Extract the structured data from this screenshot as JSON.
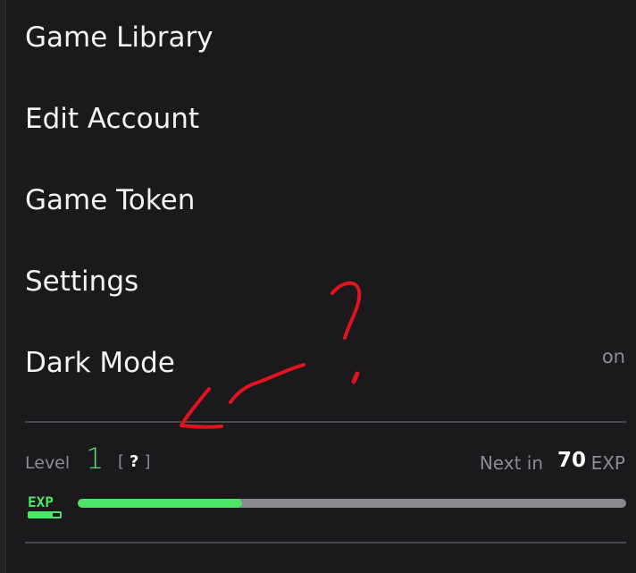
{
  "menu": {
    "items": [
      {
        "label": "Game Library"
      },
      {
        "label": "Edit Account"
      },
      {
        "label": "Game Token"
      },
      {
        "label": "Settings"
      },
      {
        "label": "Dark Mode",
        "value": "on"
      }
    ]
  },
  "level": {
    "label": "Level",
    "number": "1",
    "help_open": "[",
    "help_mark": "?",
    "help_close": "]"
  },
  "next": {
    "label": "Next in",
    "value": "70",
    "unit": "EXP"
  },
  "exp_bar": {
    "icon_text": "EXP",
    "progress_fraction": 0.3
  },
  "colors": {
    "background": "#1b191b",
    "accent_green": "#4ce667",
    "muted_text": "#8e8c91",
    "annotation_red": "#e0141f"
  }
}
